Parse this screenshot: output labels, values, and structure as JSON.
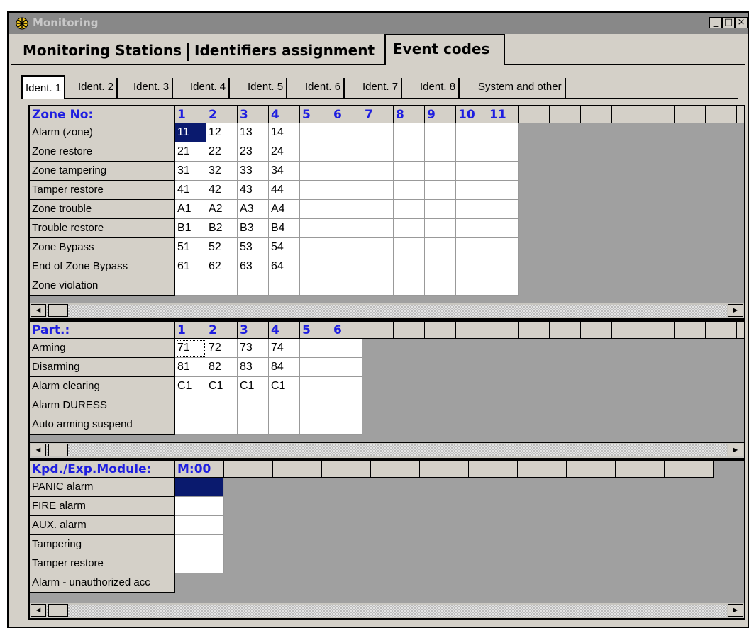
{
  "window": {
    "title": "Monitoring",
    "controls": {
      "minimize": "_",
      "maximize": "□",
      "close": "×"
    }
  },
  "main_tabs": [
    {
      "label": "Monitoring Stations",
      "active": false
    },
    {
      "label": "Identifiers assignment",
      "active": false
    },
    {
      "label": "Event codes",
      "active": true
    }
  ],
  "sub_tabs": [
    {
      "label": "Ident. 1",
      "active": true
    },
    {
      "label": "Ident. 2",
      "active": false
    },
    {
      "label": "Ident. 3",
      "active": false
    },
    {
      "label": "Ident. 4",
      "active": false
    },
    {
      "label": "Ident. 5",
      "active": false
    },
    {
      "label": "Ident. 6",
      "active": false
    },
    {
      "label": "Ident. 7",
      "active": false
    },
    {
      "label": "Ident. 8",
      "active": false
    },
    {
      "label": "System and other",
      "active": false
    }
  ],
  "zones": {
    "header": "Zone No:",
    "columns": [
      "1",
      "2",
      "3",
      "4",
      "5",
      "6",
      "7",
      "8",
      "9",
      "10",
      "11",
      "",
      "",
      "",
      "",
      "",
      "",
      "",
      ""
    ],
    "data_columns": 11,
    "rows": [
      {
        "label": "Alarm (zone)",
        "values": [
          "11",
          "12",
          "13",
          "14",
          "",
          "",
          "",
          "",
          "",
          "",
          ""
        ]
      },
      {
        "label": "Zone restore",
        "values": [
          "21",
          "22",
          "23",
          "24",
          "",
          "",
          "",
          "",
          "",
          "",
          ""
        ]
      },
      {
        "label": "Zone tampering",
        "values": [
          "31",
          "32",
          "33",
          "34",
          "",
          "",
          "",
          "",
          "",
          "",
          ""
        ]
      },
      {
        "label": "Tamper restore",
        "values": [
          "41",
          "42",
          "43",
          "44",
          "",
          "",
          "",
          "",
          "",
          "",
          ""
        ]
      },
      {
        "label": "Zone trouble",
        "values": [
          "A1",
          "A2",
          "A3",
          "A4",
          "",
          "",
          "",
          "",
          "",
          "",
          ""
        ]
      },
      {
        "label": "Trouble restore",
        "values": [
          "B1",
          "B2",
          "B3",
          "B4",
          "",
          "",
          "",
          "",
          "",
          "",
          ""
        ]
      },
      {
        "label": "Zone Bypass",
        "values": [
          "51",
          "52",
          "53",
          "54",
          "",
          "",
          "",
          "",
          "",
          "",
          ""
        ]
      },
      {
        "label": "End of Zone Bypass",
        "values": [
          "61",
          "62",
          "63",
          "64",
          "",
          "",
          "",
          "",
          "",
          "",
          ""
        ]
      },
      {
        "label": "Zone violation",
        "values": [
          "",
          "",
          "",
          "",
          "",
          "",
          "",
          "",
          "",
          "",
          ""
        ]
      }
    ]
  },
  "partitions": {
    "header": "Part.:",
    "columns": [
      "1",
      "2",
      "3",
      "4",
      "5",
      "6",
      "",
      "",
      "",
      "",
      "",
      "",
      "",
      "",
      "",
      "",
      "",
      "",
      ""
    ],
    "data_columns": 6,
    "rows": [
      {
        "label": "Arming",
        "values": [
          "71",
          "72",
          "73",
          "74",
          "",
          ""
        ]
      },
      {
        "label": "Disarming",
        "values": [
          "81",
          "82",
          "83",
          "84",
          "",
          ""
        ]
      },
      {
        "label": "Alarm clearing",
        "values": [
          "C1",
          "C1",
          "C1",
          "C1",
          "",
          ""
        ]
      },
      {
        "label": "Alarm DURESS",
        "values": [
          "",
          "",
          "",
          "",
          "",
          ""
        ]
      },
      {
        "label": "Auto arming suspend",
        "values": [
          "",
          "",
          "",
          "",
          "",
          ""
        ]
      }
    ]
  },
  "modules": {
    "header": "Kpd./Exp.Module:",
    "columns": [
      "M:00",
      "",
      "",
      "",
      "",
      "",
      "",
      "",
      "",
      "",
      ""
    ],
    "data_columns": 1,
    "rows": [
      {
        "label": "PANIC alarm",
        "values": [
          ""
        ]
      },
      {
        "label": "FIRE alarm",
        "values": [
          ""
        ]
      },
      {
        "label": "AUX. alarm",
        "values": [
          ""
        ]
      },
      {
        "label": "Tampering",
        "values": [
          ""
        ]
      },
      {
        "label": "Tamper restore",
        "values": [
          ""
        ]
      },
      {
        "label": "Alarm - unauthorized acc",
        "values": []
      }
    ]
  },
  "scroll": {
    "left_arrow": "◄",
    "right_arrow": "►"
  }
}
